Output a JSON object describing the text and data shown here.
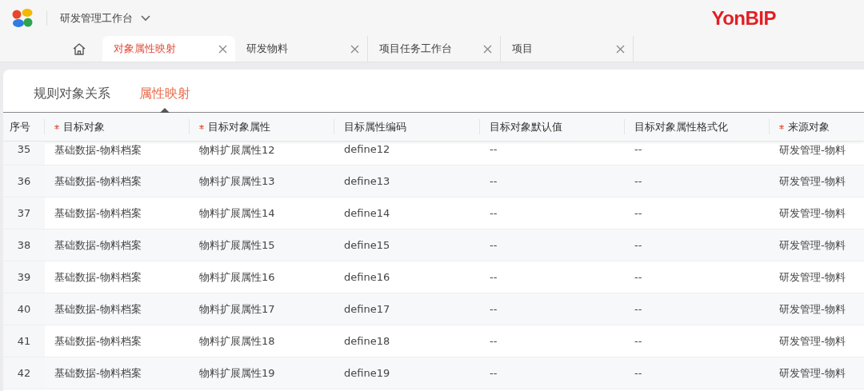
{
  "app": {
    "title": "研发管理工作台",
    "brand": "YonBIP"
  },
  "tabs": [
    {
      "kind": "home",
      "selected": false
    },
    {
      "kind": "page",
      "label": "对象属性映射",
      "selected": true
    },
    {
      "kind": "page",
      "label": "研发物料",
      "selected": false
    },
    {
      "kind": "page",
      "label": "项目任务工作台",
      "selected": false
    },
    {
      "kind": "page",
      "label": "项目",
      "selected": false
    }
  ],
  "subtabs": [
    {
      "label": "规则对象关系",
      "selected": false
    },
    {
      "label": "属性映射",
      "selected": true
    }
  ],
  "table": {
    "columns": [
      {
        "label": "序号",
        "required": false
      },
      {
        "label": "目标对象",
        "required": true
      },
      {
        "label": "目标对象属性",
        "required": true
      },
      {
        "label": "目标属性编码",
        "required": false
      },
      {
        "label": "目标对象默认值",
        "required": false
      },
      {
        "label": "目标对象属性格式化",
        "required": false
      },
      {
        "label": "来源对象",
        "required": true
      }
    ],
    "rows": [
      [
        "35",
        "基础数据-物料档案",
        "物料扩展属性12",
        "define12",
        "--",
        "--",
        "研发管理-物料"
      ],
      [
        "36",
        "基础数据-物料档案",
        "物料扩展属性13",
        "define13",
        "--",
        "--",
        "研发管理-物料"
      ],
      [
        "37",
        "基础数据-物料档案",
        "物料扩展属性14",
        "define14",
        "--",
        "--",
        "研发管理-物料"
      ],
      [
        "38",
        "基础数据-物料档案",
        "物料扩展属性15",
        "define15",
        "--",
        "--",
        "研发管理-物料"
      ],
      [
        "39",
        "基础数据-物料档案",
        "物料扩展属性16",
        "define16",
        "--",
        "--",
        "研发管理-物料"
      ],
      [
        "40",
        "基础数据-物料档案",
        "物料扩展属性17",
        "define17",
        "--",
        "--",
        "研发管理-物料"
      ],
      [
        "41",
        "基础数据-物料档案",
        "物料扩展属性18",
        "define18",
        "--",
        "--",
        "研发管理-物料"
      ],
      [
        "42",
        "基础数据-物料档案",
        "物料扩展属性19",
        "define19",
        "--",
        "--",
        "研发管理-物料"
      ]
    ]
  }
}
